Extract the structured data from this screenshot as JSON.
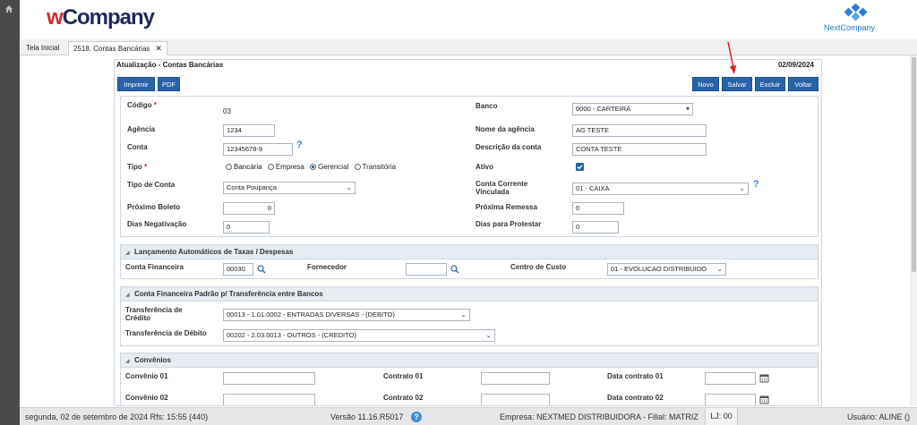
{
  "header": {
    "logo_w": "w",
    "logo_rest": "Company",
    "next_logo": "NextCompany"
  },
  "tabs": [
    {
      "label": "Tela Inicial"
    },
    {
      "label": "2518. Contas Bancárias"
    }
  ],
  "tab_close": "✕",
  "form": {
    "title": "Atualização - Contas Bancárias",
    "date": "02/09/2024"
  },
  "toolbar": {
    "imprimir": "Imprimir",
    "pdf": "PDF",
    "novo": "Novo",
    "salvar": "Salvar",
    "excluir": "Excluir",
    "voltar": "Voltar"
  },
  "fields": {
    "codigo": {
      "label": "Código",
      "value": "03"
    },
    "banco": {
      "label": "Banco",
      "value": "0000 - CARTEIRA"
    },
    "agencia": {
      "label": "Agência",
      "value": "1234"
    },
    "nome_agencia": {
      "label": "Nome da agência",
      "value": "AG TESTE"
    },
    "conta": {
      "label": "Conta",
      "value": "12345678-9"
    },
    "descricao": {
      "label": "Descrição da conta",
      "value": "CONTA TESTE"
    },
    "tipo": {
      "label": "Tipo",
      "options": [
        "Bancária",
        "Empresa",
        "Gerencial",
        "Transitória"
      ],
      "selected": "Gerencial"
    },
    "ativo": {
      "label": "Ativo",
      "checked": true
    },
    "tipo_conta": {
      "label": "Tipo de Conta",
      "value": "Conta Poupança"
    },
    "conta_corrente": {
      "label_1": "Conta Corrente",
      "label_2": "Vinculada",
      "value": "01 - CAIXA"
    },
    "proximo_boleto": {
      "label": "Próximo Boleto",
      "value": "0"
    },
    "proxima_remessa": {
      "label": "Próxima Remessa",
      "value": "0"
    },
    "dias_negativacao": {
      "label": "Dias Negativação",
      "value": "0"
    },
    "dias_protestar": {
      "label": "Dias para Protestar",
      "value": "0"
    }
  },
  "sections": {
    "lancamento": {
      "title": "Lançamento Automáticos de Taxas / Despesas",
      "conta_financeira": {
        "label": "Conta Financeira",
        "value": "00030"
      },
      "fornecedor": {
        "label": "Fornecedor",
        "value": ""
      },
      "centro_custo": {
        "label": "Centro de Custo",
        "value": "01 - EVOLUCAO DISTRIBUIDO"
      }
    },
    "conta_padrao": {
      "title": "Conta Financeira Padrão p/ Transferência entre Bancos",
      "credito": {
        "label_1": "Transferência de",
        "label_2": "Crédito",
        "value": "00013 - 1.01.0002 - ENTRADAS DIVERSAS - (DEBITO)"
      },
      "debito": {
        "label": "Transferência de Débito",
        "value": "00202 - 2.03.0013 - OUTROS - (CREDITO)"
      }
    },
    "convenios": {
      "title": "Convênios",
      "rows": [
        {
          "convenio": "Convênio 01",
          "contrato": "Contrato 01",
          "data": "Data contrato 01"
        },
        {
          "convenio": "Convênio 02",
          "contrato": "Contrato 02",
          "data": "Data contrato 02"
        }
      ]
    }
  },
  "status": {
    "date": "segunda, 02 de setembro de 2024  Rfs: 15:55 (440)",
    "version": "Versão 11.16.R5017",
    "help": "?",
    "empresa": "Empresa: NEXTMED DISTRIBUIDORA - Filial: MATRIZ",
    "lj": "LJ: 00",
    "usuario": "Usuário: ALINE ()"
  },
  "colors": {
    "primary": "#2a62a8",
    "sidebar": "#4a4a4a",
    "annotation": "#e02020"
  }
}
